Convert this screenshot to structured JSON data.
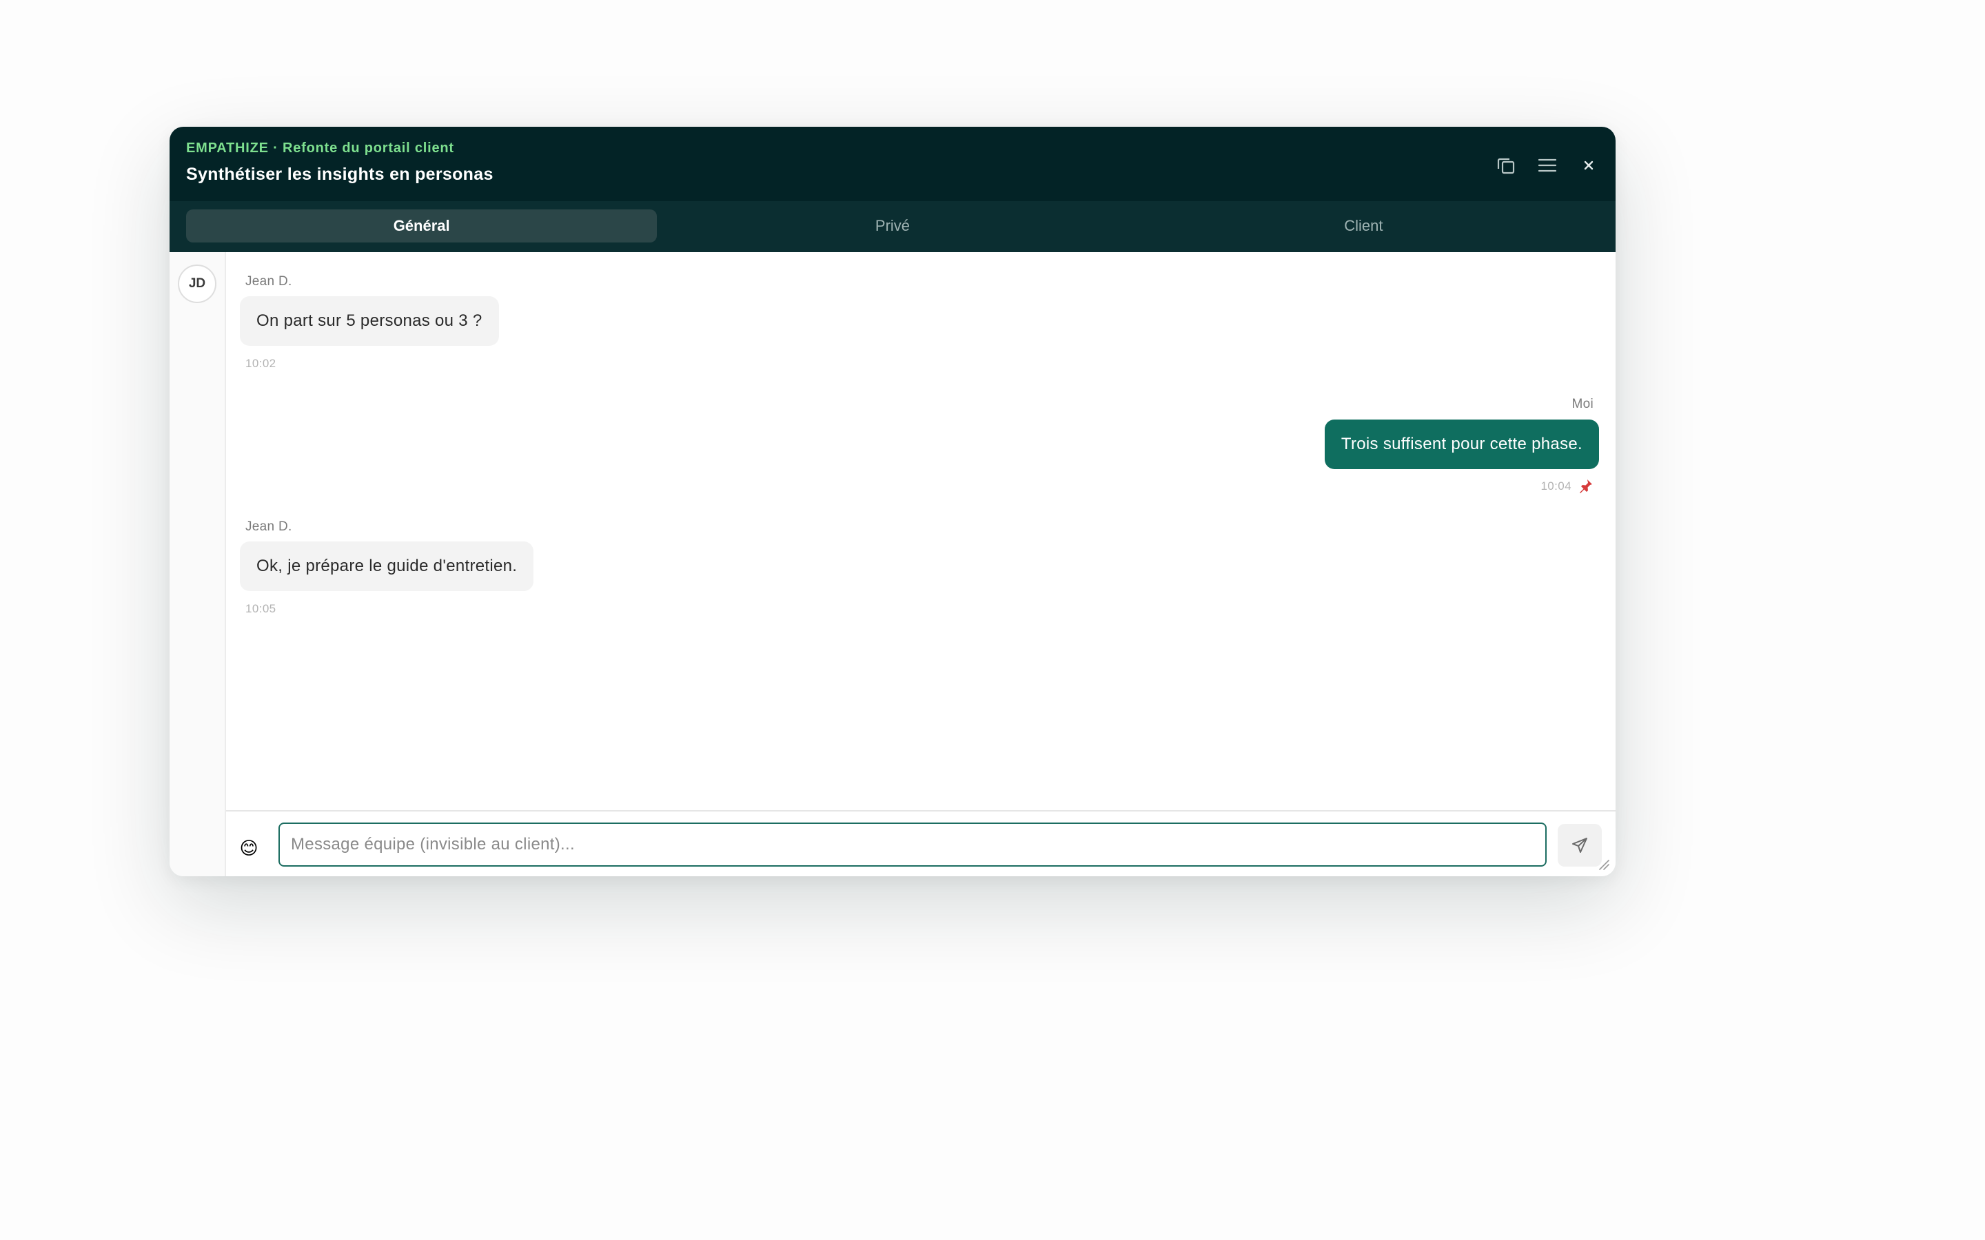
{
  "header": {
    "project": "EMPATHIZE · Refonte du portail client",
    "title": "Synthétiser les insights en personas",
    "actions": [
      "copy-window-icon",
      "menu-icon",
      "close-icon"
    ],
    "close_label": "×"
  },
  "tabs": [
    {
      "label": "Général",
      "active": true
    },
    {
      "label": "Privé",
      "active": false
    },
    {
      "label": "Client",
      "active": false
    }
  ],
  "rail": {
    "avatar_initials": "JD"
  },
  "messages": [
    {
      "author": "Jean D.",
      "text": "On part sur 5 personas ou 3 ?",
      "time": "10:02",
      "direction": "in",
      "pinned": false
    },
    {
      "author": "Moi",
      "text": "Trois suffisent pour cette phase.",
      "time": "10:04",
      "direction": "out",
      "pinned": true
    },
    {
      "author": "Jean D.",
      "text": "Ok, je prépare le guide d'entretien.",
      "time": "10:05",
      "direction": "in",
      "pinned": false
    }
  ],
  "composer": {
    "emoji": "😊",
    "placeholder": "Message équipe (invisible au client)...",
    "value": ""
  },
  "colors": {
    "header_bg": "#032326",
    "tabs_bg": "#0b2e31",
    "accent_green": "#7ee08f",
    "outgoing_bubble": "#0f6e5f",
    "incoming_bubble": "#f3f3f3",
    "pin_red": "#d63b3b"
  }
}
